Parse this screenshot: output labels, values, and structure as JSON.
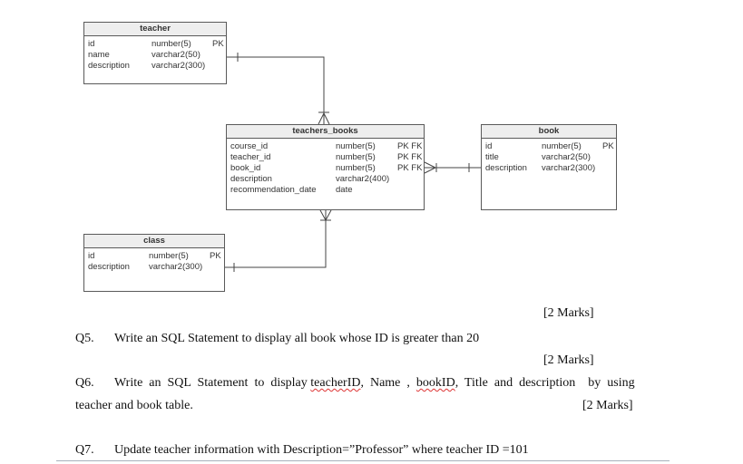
{
  "diagram": {
    "teacher": {
      "title": "teacher",
      "columns": [
        {
          "name": "id",
          "type": "number(5)",
          "key": "PK"
        },
        {
          "name": "name",
          "type": "varchar2(50)",
          "key": ""
        },
        {
          "name": "description",
          "type": "varchar2(300)",
          "key": ""
        }
      ]
    },
    "teachers_books": {
      "title": "teachers_books",
      "columns": [
        {
          "name": "course_id",
          "type": "number(5)",
          "key": "PK FK"
        },
        {
          "name": "teacher_id",
          "type": "number(5)",
          "key": "PK FK"
        },
        {
          "name": "book_id",
          "type": "number(5)",
          "key": "PK FK"
        },
        {
          "name": "description",
          "type": "varchar2(400)",
          "key": ""
        },
        {
          "name": "recommendation_date",
          "type": "date",
          "key": ""
        }
      ]
    },
    "book": {
      "title": "book",
      "columns": [
        {
          "name": "id",
          "type": "number(5)",
          "key": "PK"
        },
        {
          "name": "title",
          "type": "varchar2(50)",
          "key": ""
        },
        {
          "name": "description",
          "type": "varchar2(300)",
          "key": ""
        }
      ]
    },
    "class": {
      "title": "class",
      "columns": [
        {
          "name": "id",
          "type": "number(5)",
          "key": "PK"
        },
        {
          "name": "description",
          "type": "varchar2(300)",
          "key": ""
        }
      ]
    },
    "relationships": [
      {
        "from": "teacher",
        "to": "teachers_books",
        "from_cardinality": "one",
        "to_cardinality": "many"
      },
      {
        "from": "book",
        "to": "teachers_books",
        "from_cardinality": "one",
        "to_cardinality": "many"
      },
      {
        "from": "class",
        "to": "teachers_books",
        "from_cardinality": "one",
        "to_cardinality": "many"
      }
    ]
  },
  "questions": {
    "marks_q5": "[2 Marks]",
    "q5_number": "Q5.",
    "q5_text": "Write an SQL Statement to display all book whose ID is greater than 20",
    "marks_q6": "[2 Marks]",
    "q6_number": "Q6.",
    "q6_part1": "Write  an  SQL  Statement  to  display ",
    "q6_teacherid": "teacherID",
    "q6_part2": ",  Name  ,  ",
    "q6_bookid": "bookID",
    "q6_part3": ",  Title  and  description    by  using",
    "q6_line2": "teacher and book table.",
    "marks_q7": "[2 Marks]",
    "q7_number": "Q7.",
    "q7_text": "Update teacher information with Description=”Professor”  where teacher ID =101"
  }
}
